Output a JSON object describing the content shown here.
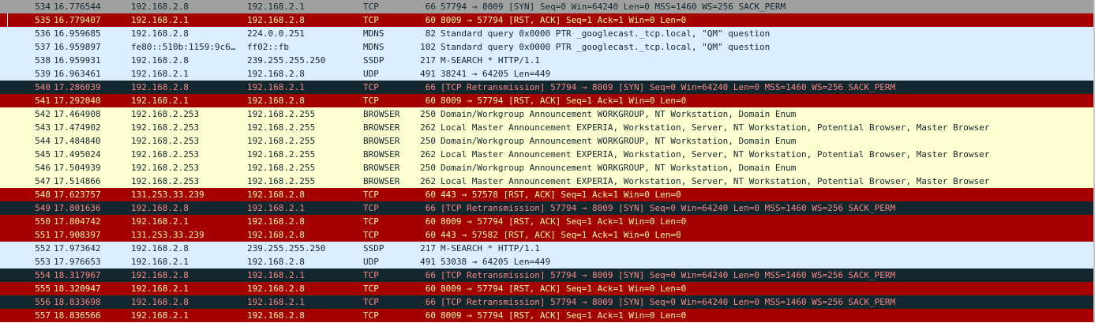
{
  "styles": {
    "gray": {
      "bg": "#a0a0a0",
      "fg": "#12272e"
    },
    "tcp_rst": {
      "bg": "#a40000",
      "fg": "#fffc9c"
    },
    "udp": {
      "bg": "#daeeff",
      "fg": "#12272e"
    },
    "bad_tcp": {
      "bg": "#12272e",
      "fg": "#f78787"
    },
    "browser": {
      "bg": "#feffd0",
      "fg": "#12272e"
    }
  },
  "packets": [
    {
      "no": "534",
      "time": "16.776544",
      "src": "192.168.2.8",
      "dst": "192.168.2.1",
      "proto": "TCP",
      "len": "66",
      "info": "57794 → 8009 [SYN] Seq=0 Win=64240 Len=0 MSS=1460 WS=256 SACK_PERM",
      "style": "gray"
    },
    {
      "no": "535",
      "time": "16.779407",
      "src": "192.168.2.1",
      "dst": "192.168.2.8",
      "proto": "TCP",
      "len": "60",
      "info": "8009 → 57794 [RST, ACK] Seq=1 Ack=1 Win=0 Len=0",
      "style": "tcp_rst",
      "selected": true
    },
    {
      "no": "536",
      "time": "16.959685",
      "src": "192.168.2.8",
      "dst": "224.0.0.251",
      "proto": "MDNS",
      "len": "82",
      "info": "Standard query 0x0000 PTR _googlecast._tcp.local, \"QM\" question",
      "style": "udp"
    },
    {
      "no": "537",
      "time": "16.959897",
      "src": "fe80::510b:1159:9c6…",
      "dst": "ff02::fb",
      "proto": "MDNS",
      "len": "102",
      "info": "Standard query 0x0000 PTR _googlecast._tcp.local, \"QM\" question",
      "style": "udp"
    },
    {
      "no": "538",
      "time": "16.959931",
      "src": "192.168.2.8",
      "dst": "239.255.255.250",
      "proto": "SSDP",
      "len": "217",
      "info": "M-SEARCH * HTTP/1.1",
      "style": "udp"
    },
    {
      "no": "539",
      "time": "16.963461",
      "src": "192.168.2.1",
      "dst": "192.168.2.8",
      "proto": "UDP",
      "len": "491",
      "info": "38241 → 64205 Len=449",
      "style": "udp"
    },
    {
      "no": "540",
      "time": "17.286039",
      "src": "192.168.2.8",
      "dst": "192.168.2.1",
      "proto": "TCP",
      "len": "66",
      "info": "[TCP Retransmission] 57794 → 8009 [SYN] Seq=0 Win=64240 Len=0 MSS=1460 WS=256 SACK_PERM",
      "style": "bad_tcp"
    },
    {
      "no": "541",
      "time": "17.292040",
      "src": "192.168.2.1",
      "dst": "192.168.2.8",
      "proto": "TCP",
      "len": "60",
      "info": "8009 → 57794 [RST, ACK] Seq=1 Ack=1 Win=0 Len=0",
      "style": "tcp_rst"
    },
    {
      "no": "542",
      "time": "17.464908",
      "src": "192.168.2.253",
      "dst": "192.168.2.255",
      "proto": "BROWSER",
      "len": "250",
      "info": "Domain/Workgroup Announcement WORKGROUP, NT Workstation, Domain Enum",
      "style": "browser"
    },
    {
      "no": "543",
      "time": "17.474902",
      "src": "192.168.2.253",
      "dst": "192.168.2.255",
      "proto": "BROWSER",
      "len": "262",
      "info": "Local Master Announcement EXPERIA, Workstation, Server, NT Workstation, Potential Browser, Master Browser",
      "style": "browser"
    },
    {
      "no": "544",
      "time": "17.484840",
      "src": "192.168.2.253",
      "dst": "192.168.2.255",
      "proto": "BROWSER",
      "len": "250",
      "info": "Domain/Workgroup Announcement WORKGROUP, NT Workstation, Domain Enum",
      "style": "browser"
    },
    {
      "no": "545",
      "time": "17.495024",
      "src": "192.168.2.253",
      "dst": "192.168.2.255",
      "proto": "BROWSER",
      "len": "262",
      "info": "Local Master Announcement EXPERIA, Workstation, Server, NT Workstation, Potential Browser, Master Browser",
      "style": "browser"
    },
    {
      "no": "546",
      "time": "17.504939",
      "src": "192.168.2.253",
      "dst": "192.168.2.255",
      "proto": "BROWSER",
      "len": "250",
      "info": "Domain/Workgroup Announcement WORKGROUP, NT Workstation, Domain Enum",
      "style": "browser"
    },
    {
      "no": "547",
      "time": "17.514866",
      "src": "192.168.2.253",
      "dst": "192.168.2.255",
      "proto": "BROWSER",
      "len": "262",
      "info": "Local Master Announcement EXPERIA, Workstation, Server, NT Workstation, Potential Browser, Master Browser",
      "style": "browser"
    },
    {
      "no": "548",
      "time": "17.623757",
      "src": "131.253.33.239",
      "dst": "192.168.2.8",
      "proto": "TCP",
      "len": "60",
      "info": "443 → 57578 [RST, ACK] Seq=1 Ack=1 Win=0 Len=0",
      "style": "tcp_rst"
    },
    {
      "no": "549",
      "time": "17.801636",
      "src": "192.168.2.8",
      "dst": "192.168.2.1",
      "proto": "TCP",
      "len": "66",
      "info": "[TCP Retransmission] 57794 → 8009 [SYN] Seq=0 Win=64240 Len=0 MSS=1460 WS=256 SACK_PERM",
      "style": "bad_tcp"
    },
    {
      "no": "550",
      "time": "17.804742",
      "src": "192.168.2.1",
      "dst": "192.168.2.8",
      "proto": "TCP",
      "len": "60",
      "info": "8009 → 57794 [RST, ACK] Seq=1 Ack=1 Win=0 Len=0",
      "style": "tcp_rst"
    },
    {
      "no": "551",
      "time": "17.908397",
      "src": "131.253.33.239",
      "dst": "192.168.2.8",
      "proto": "TCP",
      "len": "60",
      "info": "443 → 57582 [RST, ACK] Seq=1 Ack=1 Win=0 Len=0",
      "style": "tcp_rst"
    },
    {
      "no": "552",
      "time": "17.973642",
      "src": "192.168.2.8",
      "dst": "239.255.255.250",
      "proto": "SSDP",
      "len": "217",
      "info": "M-SEARCH * HTTP/1.1",
      "style": "udp"
    },
    {
      "no": "553",
      "time": "17.976653",
      "src": "192.168.2.1",
      "dst": "192.168.2.8",
      "proto": "UDP",
      "len": "491",
      "info": "53038 → 64205 Len=449",
      "style": "udp"
    },
    {
      "no": "554",
      "time": "18.317967",
      "src": "192.168.2.8",
      "dst": "192.168.2.1",
      "proto": "TCP",
      "len": "66",
      "info": "[TCP Retransmission] 57794 → 8009 [SYN] Seq=0 Win=64240 Len=0 MSS=1460 WS=256 SACK_PERM",
      "style": "bad_tcp"
    },
    {
      "no": "555",
      "time": "18.320947",
      "src": "192.168.2.1",
      "dst": "192.168.2.8",
      "proto": "TCP",
      "len": "60",
      "info": "8009 → 57794 [RST, ACK] Seq=1 Ack=1 Win=0 Len=0",
      "style": "tcp_rst"
    },
    {
      "no": "556",
      "time": "18.833698",
      "src": "192.168.2.8",
      "dst": "192.168.2.1",
      "proto": "TCP",
      "len": "66",
      "info": "[TCP Retransmission] 57794 → 8009 [SYN] Seq=0 Win=64240 Len=0 MSS=1460 WS=256 SACK_PERM",
      "style": "bad_tcp"
    },
    {
      "no": "557",
      "time": "18.836566",
      "src": "192.168.2.1",
      "dst": "192.168.2.8",
      "proto": "TCP",
      "len": "60",
      "info": "8009 → 57794 [RST, ACK] Seq=1 Ack=1 Win=0 Len=0",
      "style": "tcp_rst"
    }
  ]
}
